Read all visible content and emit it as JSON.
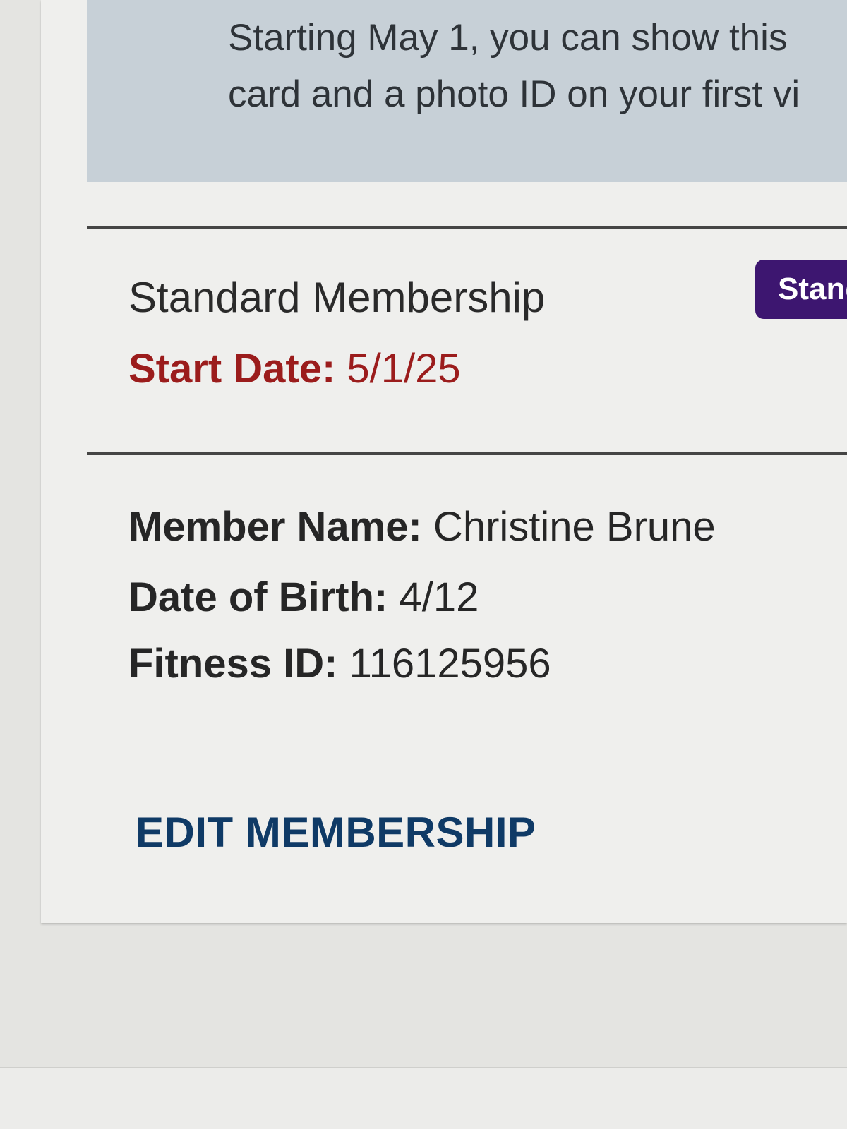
{
  "notice": {
    "text": "Starting May 1, you can show this\ncard and a photo ID on your first vi"
  },
  "membership": {
    "title": "Standard Membership",
    "badge": "Standa",
    "start_date_label": "Start Date:",
    "start_date_value": " 5/1/25"
  },
  "member": {
    "name_label": "Member Name:",
    "name_value": " Christine Brune",
    "dob_label": "Date of Birth:",
    "dob_value": " 4/12",
    "fitness_id_label": "Fitness ID:",
    "fitness_id_value": " 116125956"
  },
  "actions": {
    "edit_label": "EDIT MEMBERSHIP"
  },
  "colors": {
    "accent_red": "#9b1c1c",
    "badge_purple": "#3d1670",
    "link_blue": "#0f3a66",
    "notice_bg": "#c7d0d7"
  }
}
